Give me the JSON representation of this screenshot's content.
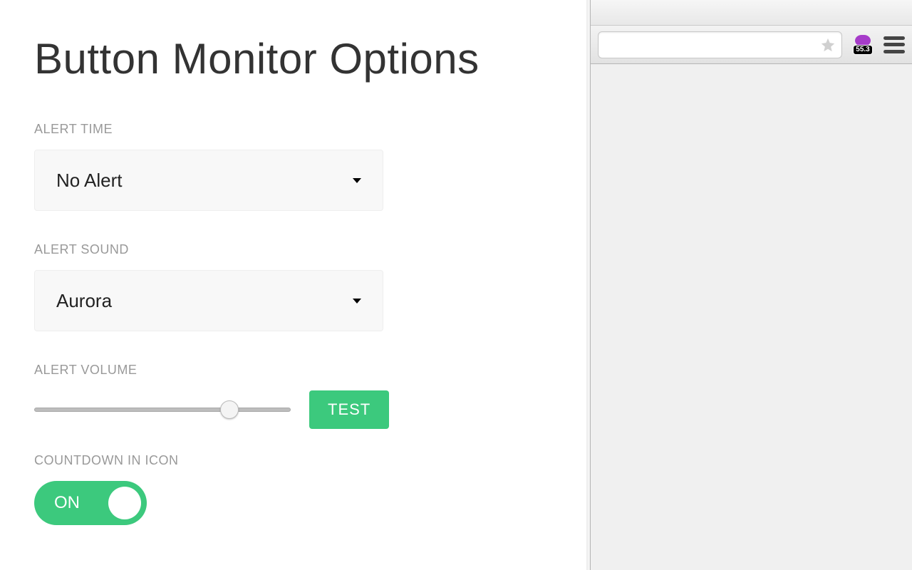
{
  "title": "Button Monitor Options",
  "alert_time": {
    "label": "ALERT TIME",
    "value": "No Alert"
  },
  "alert_sound": {
    "label": "ALERT SOUND",
    "value": "Aurora"
  },
  "alert_volume": {
    "label": "ALERT VOLUME",
    "position_pct": 76,
    "test_label": "TEST"
  },
  "countdown": {
    "label": "COUNTDOWN IN ICON",
    "state_label": "ON"
  },
  "extension_badge": "55.3"
}
